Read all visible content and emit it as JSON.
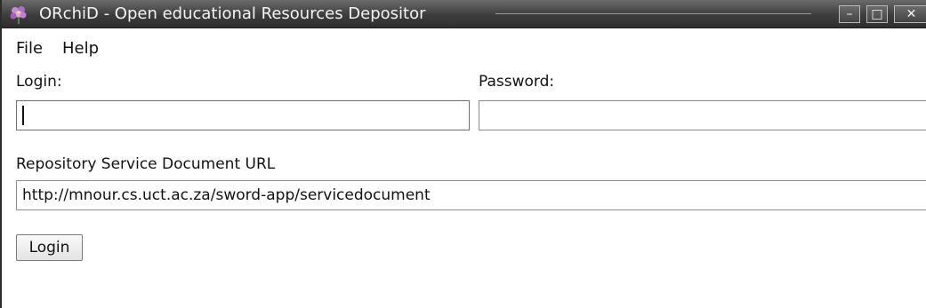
{
  "window": {
    "title": "ORchiD - Open educational Resources Depositor",
    "controls": {
      "minimize": "–",
      "maximize": "□",
      "close": "✕"
    },
    "icon": "flower-icon"
  },
  "menubar": {
    "items": [
      "File",
      "Help"
    ]
  },
  "form": {
    "login_label": "Login:",
    "login_value": "",
    "password_label": "Password:",
    "password_value": "",
    "url_label": "Repository Service Document URL",
    "url_value": "http://mnour.cs.uct.ac.za/sword-app/servicedocument",
    "login_button": "Login"
  },
  "colors": {
    "titlebar": "#3d3d3d",
    "window_bg": "#ffffff"
  }
}
